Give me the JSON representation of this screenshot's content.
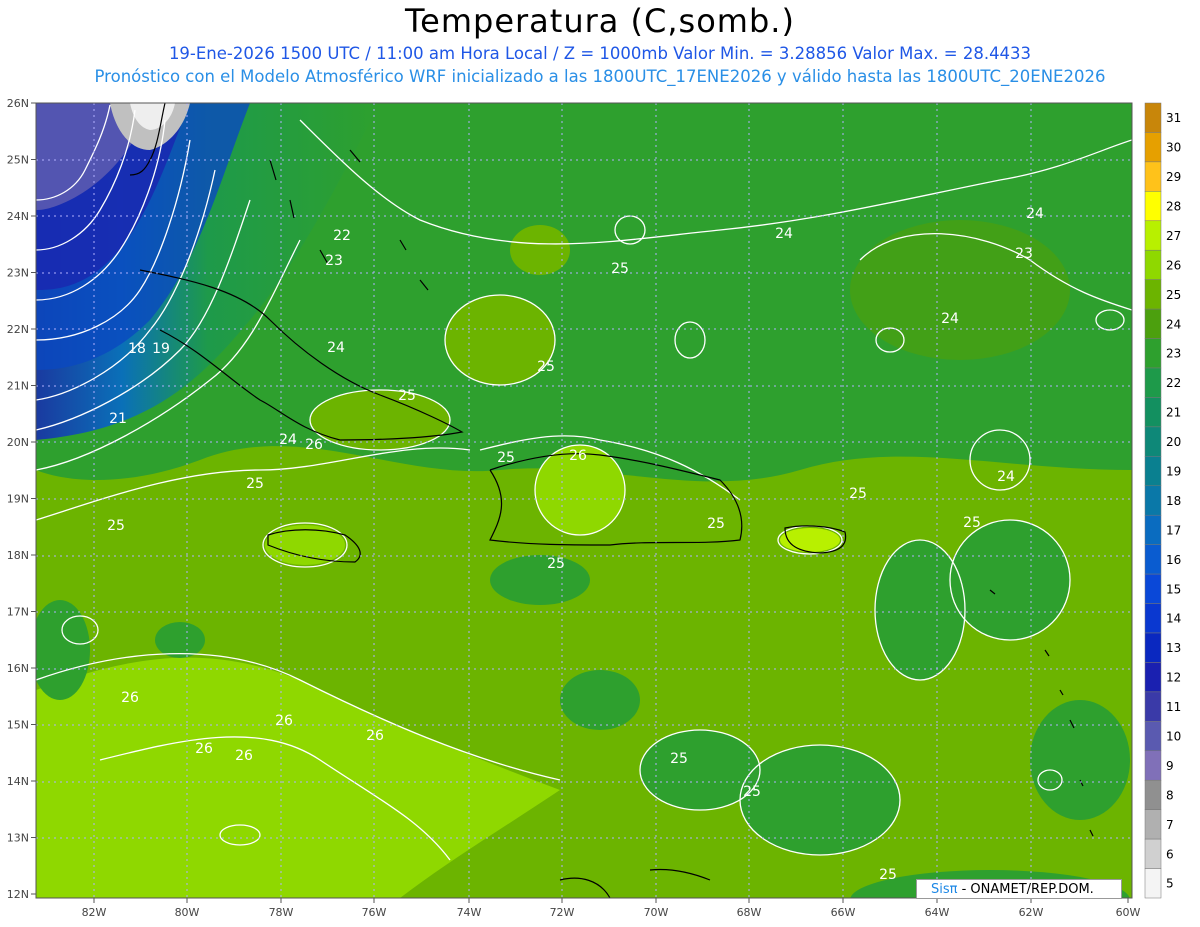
{
  "title": "Temperatura (C,somb.)",
  "subtitle_line1": "19-Ene-2026 1500 UTC / 11:00 am Hora Local / Z = 1000mb   Valor Min. = 3.28856   Valor Max. = 28.4433",
  "subtitle_line2": "Pronóstico con el Modelo Atmosférico WRF inicializado a las 1800UTC_17ENE2026 y válido hasta las  1800UTC_20ENE2026",
  "credit": {
    "brand": "Sisπ",
    "rest": " - ONAMET/REP.DOM."
  },
  "lon_labels": [
    "82W",
    "80W",
    "78W",
    "76W",
    "74W",
    "72W",
    "70W",
    "68W",
    "66W",
    "64W",
    "62W",
    "60W"
  ],
  "lat_labels": [
    "26N",
    "25N",
    "24N",
    "23N",
    "22N",
    "21N",
    "20N",
    "19N",
    "18N",
    "17N",
    "16N",
    "15N",
    "14N",
    "13N",
    "12N"
  ],
  "colorbar": {
    "levels": [
      "31",
      "30",
      "29",
      "28",
      "27",
      "26",
      "25",
      "24",
      "23",
      "22",
      "21",
      "20",
      "19",
      "18",
      "17",
      "16",
      "15",
      "14",
      "13",
      "12",
      "11",
      "10",
      "9",
      "8",
      "7",
      "6",
      "5"
    ],
    "colors": [
      "#c8860a",
      "#e6a000",
      "#ffc21a",
      "#ffff00",
      "#b8f000",
      "#8fd800",
      "#6cb400",
      "#4ca00e",
      "#2ea02e",
      "#1e9a4a",
      "#139060",
      "#0e8878",
      "#0a8090",
      "#0a78a8",
      "#0a6cc0",
      "#0a5cd0",
      "#0a48d8",
      "#0a38d0",
      "#0a28c0",
      "#1a20b0",
      "#3a3aa8",
      "#5a5ab0",
      "#8070b8",
      "#909090",
      "#b0b0b0",
      "#d0d0d0",
      "#f4f4f4"
    ]
  },
  "contour_labels": [
    "25",
    "26",
    "24",
    "23",
    "22",
    "21",
    "18",
    "19",
    "25",
    "24",
    "26",
    "25",
    "24",
    "23",
    "24",
    "25",
    "25",
    "26",
    "25",
    "26",
    "26",
    "26",
    "26",
    "25",
    "25",
    "25",
    "24",
    "25",
    "24",
    "25",
    "25",
    "25"
  ]
}
